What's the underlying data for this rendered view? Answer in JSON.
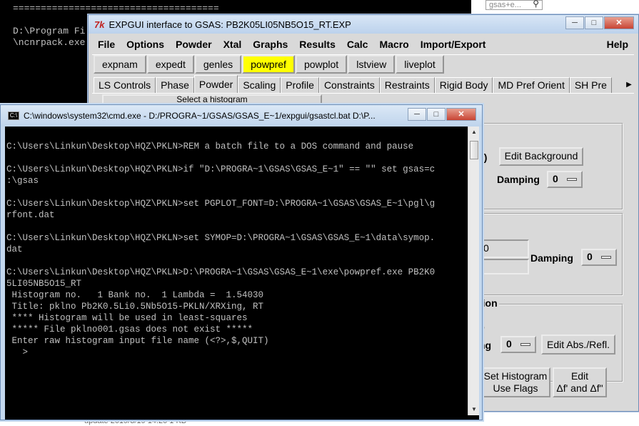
{
  "background_console": {
    "lines": [
      "=====================================",
      "",
      "D:\\Program Fi",
      "\\ncnrpack.exe"
    ]
  },
  "background_window": {
    "search_placeholder": "gsas+e...",
    "bottom_text": "update                    2019/3/19 14:20         1 KB"
  },
  "expgui": {
    "title": "EXPGUI interface to GSAS: PB2K05LI05NB5O15_RT.EXP",
    "tk_logo": "7k",
    "menu": [
      "File",
      "Options",
      "Powder",
      "Xtal",
      "Graphs",
      "Results",
      "Calc",
      "Macro",
      "Import/Export"
    ],
    "help": "Help",
    "buttons": [
      "expnam",
      "expedt",
      "genles",
      "powpref",
      "powplot",
      "lstview",
      "liveplot"
    ],
    "active_button": "powpref",
    "tabs": [
      "LS Controls",
      "Phase",
      "Powder",
      "Scaling",
      "Profile",
      "Constraints",
      "Restraints",
      "Rigid Body",
      "MD Pref Orient",
      "SH Pre"
    ],
    "active_tab": "Powder",
    "select_histogram": "Select a histogram",
    "background": {
      "label_partial": "s)",
      "edit_button": "Edit Background",
      "damping_label": "Damping",
      "damping_value": "0"
    },
    "diffractometer": {
      "entry_value": "0",
      "damping_label": "Damping",
      "damping_value": "0"
    },
    "absorption": {
      "title_partial": "tion",
      "value_partial": "0",
      "damping_partial": "ng",
      "damping_value": "0",
      "edit_button": "Edit Abs./Refl."
    },
    "set_flags_button": "Set Histogram\nUse Flags",
    "edit_f_button": "Edit\nΔf' and Δf\""
  },
  "cmd": {
    "title": "C:\\windows\\system32\\cmd.exe - D:/PROGRA~1/GSAS/GSAS_E~1/expgui/gsastcl.bat   D:\\P...",
    "lines": [
      "",
      "C:\\Users\\Linkun\\Desktop\\HQZ\\PKLN>REM a batch file to a DOS command and pause",
      "",
      "C:\\Users\\Linkun\\Desktop\\HQZ\\PKLN>if \"D:\\PROGRA~1\\GSAS\\GSAS_E~1\" == \"\" set gsas=c",
      ":\\gsas",
      "",
      "C:\\Users\\Linkun\\Desktop\\HQZ\\PKLN>set PGPLOT_FONT=D:\\PROGRA~1\\GSAS\\GSAS_E~1\\pgl\\g",
      "rfont.dat",
      "",
      "C:\\Users\\Linkun\\Desktop\\HQZ\\PKLN>set SYMOP=D:\\PROGRA~1\\GSAS\\GSAS_E~1\\data\\symop.",
      "dat",
      "",
      "C:\\Users\\Linkun\\Desktop\\HQZ\\PKLN>D:\\PROGRA~1\\GSAS\\GSAS_E~1\\exe\\powpref.exe PB2K0",
      "5LI05NB5O15_RT",
      " Histogram no.   1 Bank no.  1 Lambda =  1.54030",
      " Title: pklno Pb2K0.5Li0.5Nb5O15-PKLN/XRXing, RT",
      " **** Histogram will be used in least-squares",
      " ***** File pklno001.gsas does not exist *****",
      " Enter raw histogram input file name (<?>,$,QUIT)",
      "   >"
    ]
  }
}
